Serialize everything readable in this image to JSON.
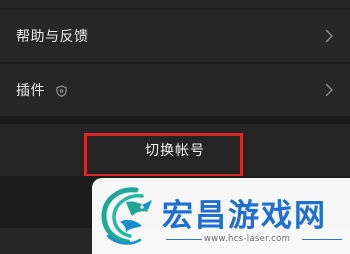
{
  "settings": {
    "help_feedback_label": "帮助与反馈",
    "plugins_label": "插件",
    "switch_account_label": "切换帐号"
  },
  "icons": {
    "chevron": "chevron-right-icon",
    "shield": "shield-icon"
  },
  "colors": {
    "background": "#1e1e1e",
    "row": "#262626",
    "text": "#ececec",
    "highlight_border": "#d62a2a",
    "watermark_blue": "#1e6fd0"
  },
  "watermark": {
    "title": "宏昌游戏网",
    "url": "www.hcs-laser.com"
  }
}
